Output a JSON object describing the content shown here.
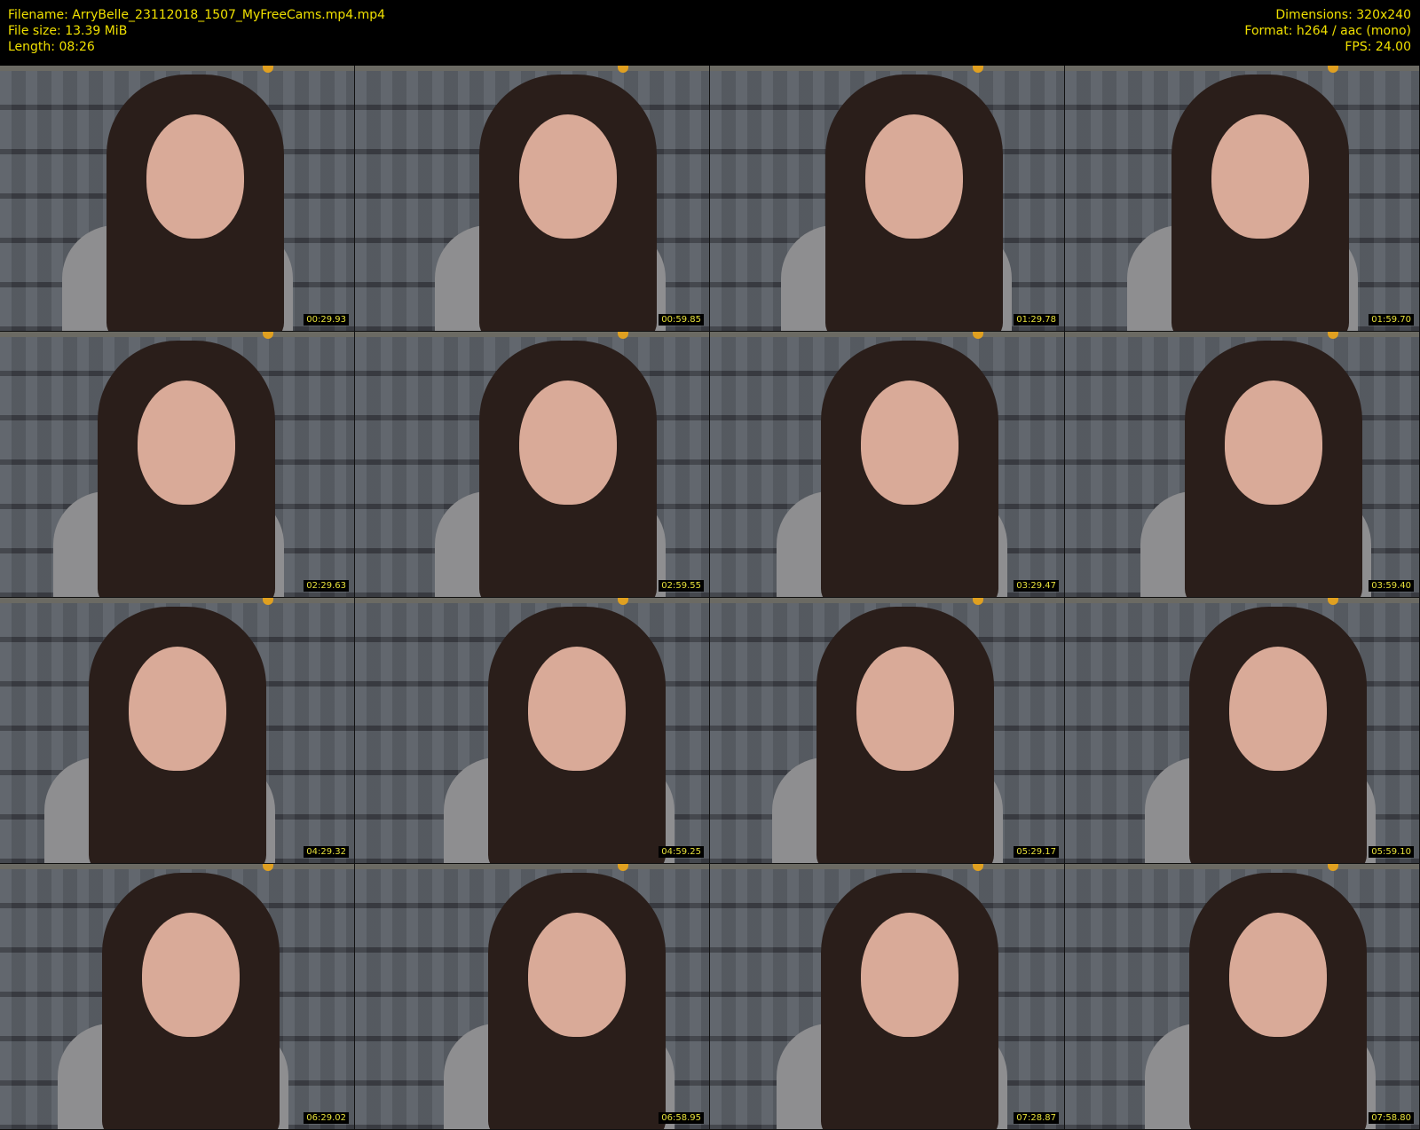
{
  "header": {
    "filename": "Filename: ArryBelle_23112018_1507_MyFreeCams.mp4.mp4",
    "filesize": "File size: 13.39 MiB",
    "length": "Length: 08:26",
    "dimensions": "Dimensions: 320x240",
    "format": "Format: h264 / aac (mono)",
    "fps": "FPS: 24.00"
  },
  "thumbnails": [
    "00:29.93",
    "00:59.85",
    "01:29.78",
    "01:59.70",
    "02:29.63",
    "02:59.55",
    "03:29.47",
    "03:59.40",
    "04:29.32",
    "04:59.25",
    "05:29.17",
    "05:59.10",
    "06:29.02",
    "06:58.95",
    "07:28.87",
    "07:58.80"
  ]
}
